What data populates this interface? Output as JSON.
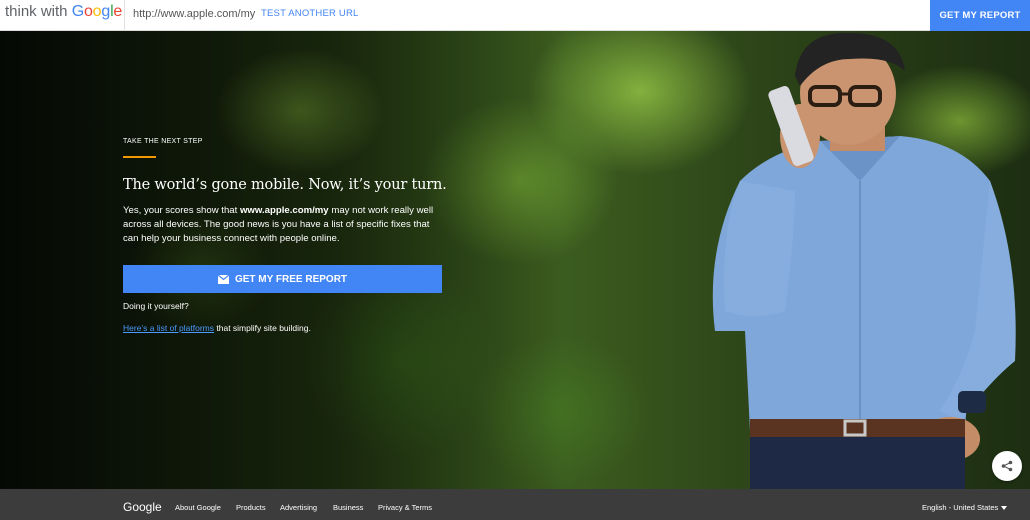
{
  "header": {
    "brand_prefix": "think with ",
    "brand_google": [
      "G",
      "o",
      "o",
      "g",
      "l",
      "e"
    ],
    "url": "http://www.apple.com/my",
    "test_link": "TEST ANOTHER URL",
    "report_button": "GET MY REPORT"
  },
  "hero": {
    "eyebrow": "TAKE THE NEXT STEP",
    "headline": "The world’s gone mobile. Now, it’s your turn.",
    "body_prefix": "Yes, your scores show that ",
    "body_site": "www.apple.com/my",
    "body_suffix": " may not work really well across all devices. The good news is you have a list of specific fixes that can help your business connect with people online.",
    "cta_label": "GET MY FREE REPORT",
    "cta_icon": "envelope-icon",
    "diy_label": "Doing it yourself?",
    "platforms_link": "Here’s a list of platforms",
    "platforms_suffix": " that simplify site building.",
    "share_icon": "share-icon"
  },
  "footer": {
    "logo": "Google",
    "links": [
      "About Google",
      "Products",
      "Advertising",
      "Business",
      "Privacy & Terms"
    ],
    "language": "English - United States"
  },
  "colors": {
    "accent_blue": "#4285f4",
    "eyebrow_rule": "#f29900",
    "footer_bg": "#3c3c3c"
  }
}
